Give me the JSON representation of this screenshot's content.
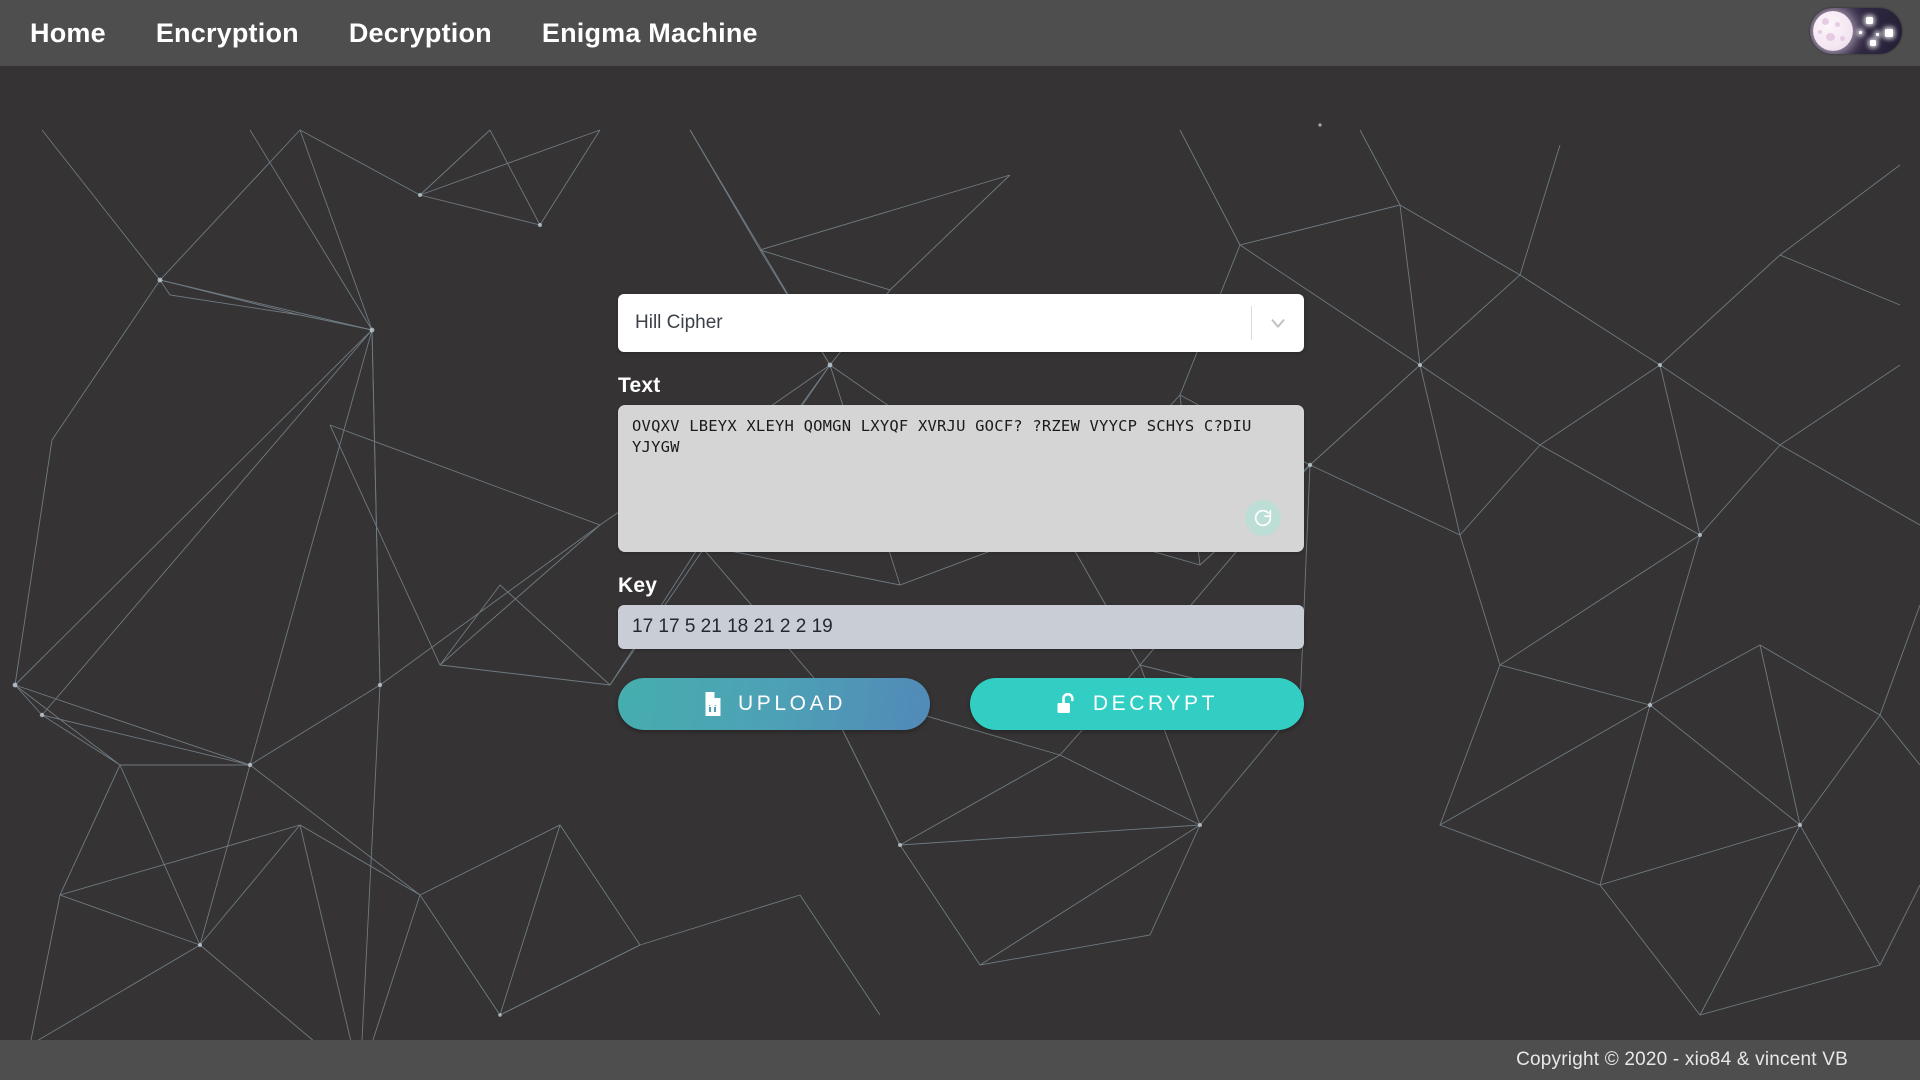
{
  "navbar": {
    "links": [
      {
        "label": "Home",
        "name": "nav-link-home"
      },
      {
        "label": "Encryption",
        "name": "nav-link-encryption"
      },
      {
        "label": "Decryption",
        "name": "nav-link-decryption"
      },
      {
        "label": "Enigma Machine",
        "name": "nav-link-enigma-machine"
      }
    ],
    "theme_toggle": {
      "state": "dark",
      "icon": "moon-stars-icon"
    }
  },
  "form": {
    "cipher_select": {
      "selected": "Hill Cipher",
      "icon": "chevron-down-icon",
      "options": [
        "Hill Cipher"
      ]
    },
    "text_field": {
      "label": "Text",
      "value": "OVQXV LBEYX XLEYH QOMGN LXYQF XVRJU GOCF? ?RZEW VYYCP SCHYS C?DIU YJYGW",
      "placeholder": "",
      "refresh_icon": "refresh-circle-icon"
    },
    "key_field": {
      "label": "Key",
      "value": "17 17 5 21 18 21 2 2 19",
      "placeholder": ""
    },
    "buttons": {
      "upload": {
        "label": "UPLOAD",
        "icon": "file-upload-icon"
      },
      "decrypt": {
        "label": "DECRYPT",
        "icon": "unlock-icon"
      }
    }
  },
  "footer": {
    "text": "Copyright © 2020 - xio84 & vincent VB"
  },
  "colors": {
    "page_background": "#353333",
    "navbar": "#4e4e4e",
    "footer": "#4e4e4e",
    "textarea_background": "#d5d5d5",
    "key_background": "#c8cdd6",
    "upload_gradient_start": "#46aeae",
    "upload_gradient_end": "#5289b8",
    "decrypt_accent": "#32cec3",
    "particle_line": "#9fb4c4"
  }
}
